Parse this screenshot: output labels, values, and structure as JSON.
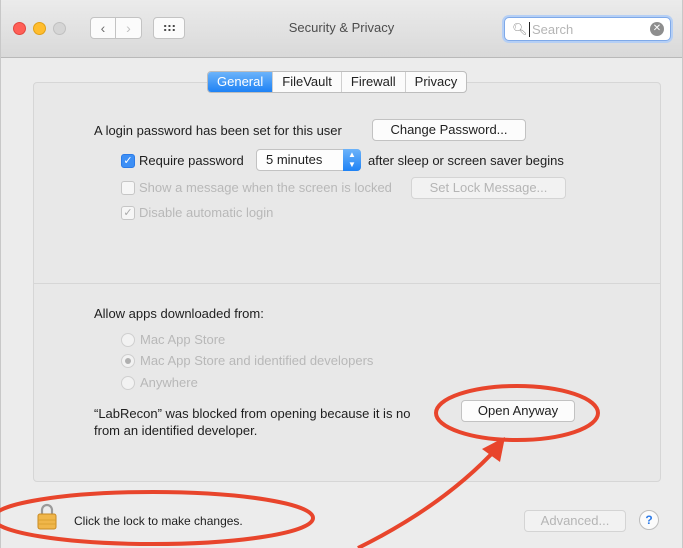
{
  "window": {
    "title": "Security & Privacy",
    "nav_back": "‹",
    "nav_forward": "›"
  },
  "search": {
    "placeholder": "Search",
    "clear": "✕"
  },
  "tabs": [
    {
      "label": "General",
      "active": true
    },
    {
      "label": "FileVault",
      "active": false
    },
    {
      "label": "Firewall",
      "active": false
    },
    {
      "label": "Privacy",
      "active": false
    }
  ],
  "general": {
    "login_text": "A login password has been set for this user",
    "change_password": "Change Password...",
    "require_password_label": "Require password",
    "require_password_checked": true,
    "require_password_delay": "5 minutes",
    "after_sleep_text": "after sleep or screen saver begins",
    "show_message_label": "Show a message when the screen is locked",
    "set_lock_message": "Set Lock Message...",
    "disable_login_label": "Disable automatic login",
    "disable_login_checked": true
  },
  "apps": {
    "heading": "Allow apps downloaded from:",
    "options": [
      {
        "label": "Mac App Store",
        "selected": false
      },
      {
        "label": "Mac App Store and identified developers",
        "selected": true
      },
      {
        "label": "Anywhere",
        "selected": false
      }
    ],
    "blocked_line1": "“LabRecon” was blocked from opening because it is no",
    "blocked_line2": "from an identified developer.",
    "open_anyway": "Open Anyway"
  },
  "footer": {
    "lock_text": "Click the lock to make changes.",
    "advanced": "Advanced...",
    "help": "?"
  },
  "annotations": {
    "color": "#e8452c"
  }
}
